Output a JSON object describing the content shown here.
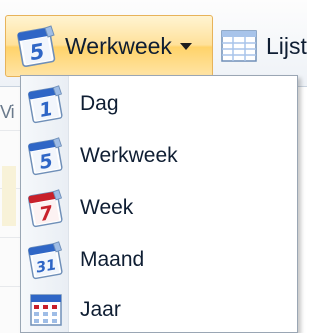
{
  "toolbar": {
    "current_view_label": "Werkweek",
    "current_view_icon": "calendar-workweek-icon",
    "current_view_icon_number": "5",
    "next_button_label": "Lijst",
    "next_button_icon": "list-grid-icon",
    "background_fragment": "Vi"
  },
  "menu": {
    "items": [
      {
        "label": "Dag",
        "icon": "calendar-day-icon",
        "icon_number": "1",
        "icon_color": "#2f66c6"
      },
      {
        "label": "Werkweek",
        "icon": "calendar-workweek-icon",
        "icon_number": "5",
        "icon_color": "#2f66c6"
      },
      {
        "label": "Week",
        "icon": "calendar-week-icon",
        "icon_number": "7",
        "icon_color": "#c8202a"
      },
      {
        "label": "Maand",
        "icon": "calendar-month-icon",
        "icon_number": "31",
        "icon_color": "#2f66c6"
      },
      {
        "label": "Jaar",
        "icon": "calendar-year-icon",
        "icon_number": "",
        "icon_color": "#c8202a"
      }
    ]
  },
  "colors": {
    "button_border": "#e7b35a",
    "button_fill": "#ffd36a",
    "text": "#0f1e33",
    "menu_border": "#9aa6b4"
  }
}
